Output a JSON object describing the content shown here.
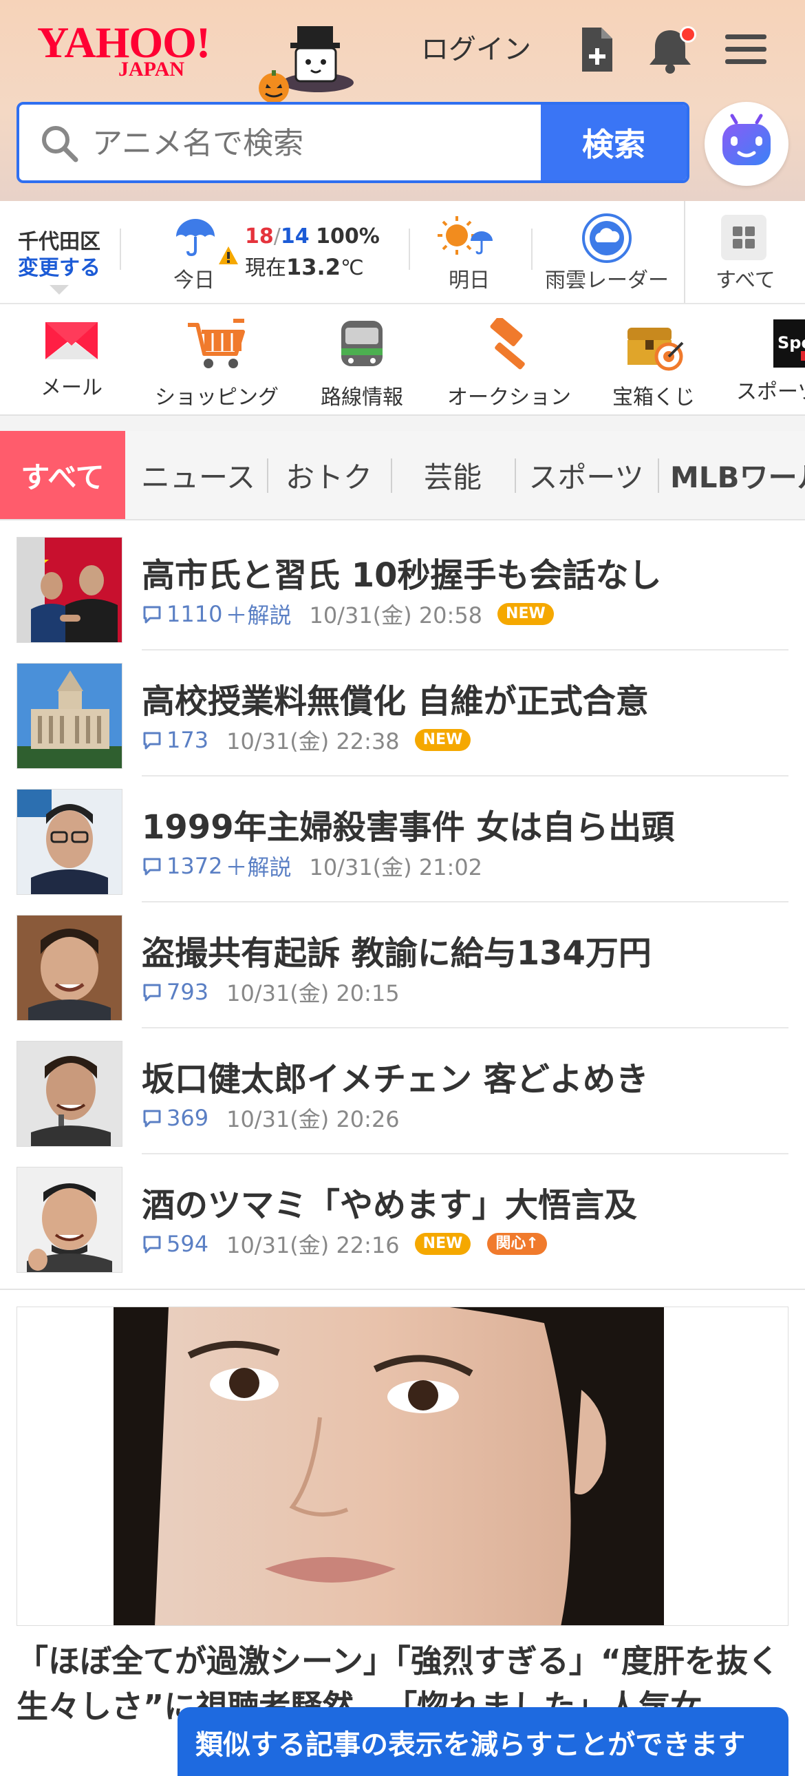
{
  "header": {
    "logo_main": "YAHOO!",
    "logo_sub": "JAPAN",
    "login_label": "ログイン"
  },
  "search": {
    "placeholder": "アニメ名で検索",
    "button_label": "検索"
  },
  "weather": {
    "area_name": "千代田区",
    "change_label": "変更する",
    "today_label": "今日",
    "temp_high": "18",
    "temp_low": "14",
    "rain_chance": "100%",
    "current_prefix": "現在",
    "current_temp": "13.2",
    "current_unit": "℃",
    "tomorrow_label": "明日",
    "radar_label": "雨雲レーダー",
    "all_label": "すべて"
  },
  "services": [
    {
      "label": "メール",
      "icon": "mail-icon"
    },
    {
      "label": "ショッピング",
      "icon": "shopping-cart-icon"
    },
    {
      "label": "路線情報",
      "icon": "train-icon"
    },
    {
      "label": "オークション",
      "icon": "auction-hammer-icon"
    },
    {
      "label": "宝箱くじ",
      "icon": "treasure-box-icon"
    },
    {
      "label": "スポーツ",
      "icon": "sports-icon"
    }
  ],
  "tabs": [
    "すべて",
    "ニュース",
    "おトク",
    "芸能",
    "スポーツ",
    "MLBワールドシリーズ"
  ],
  "news": [
    {
      "title": "高市氏と習氏 10秒握手も会話なし",
      "comments": "1110",
      "kaisetsu": "＋解説",
      "date": "10/31(金) 20:58",
      "badge": "NEW"
    },
    {
      "title": "高校授業料無償化 自維が正式合意",
      "comments": "173",
      "kaisetsu": "",
      "date": "10/31(金) 22:38",
      "badge": "NEW"
    },
    {
      "title": "1999年主婦殺害事件 女は自ら出頭",
      "comments": "1372",
      "kaisetsu": "＋解説",
      "date": "10/31(金) 21:02",
      "badge": ""
    },
    {
      "title": "盗撮共有起訴 教諭に給与134万円",
      "comments": "793",
      "kaisetsu": "",
      "date": "10/31(金) 20:15",
      "badge": ""
    },
    {
      "title": "坂口健太郎イメチェン 客どよめき",
      "comments": "369",
      "kaisetsu": "",
      "date": "10/31(金) 20:26",
      "badge": ""
    },
    {
      "title": "酒のツマミ「やめます」大悟言及",
      "comments": "594",
      "kaisetsu": "",
      "date": "10/31(金) 22:16",
      "badge": "NEW",
      "badge2": "関心↑"
    }
  ],
  "feature": {
    "title": "「ほぼ全てが過激シーン」「強烈すぎる」“度肝を抜く生々しさ”に視聴者騒然…「惚れました」人気女"
  },
  "toast": {
    "text": "類似する記事の表示を減らすことができます"
  },
  "colors": {
    "brand": "#ff0033",
    "accent_blue": "#3a75f5",
    "tab_active": "#ff5c6c",
    "badge_new": "#f5a800",
    "badge_interest": "#f07a2c"
  }
}
